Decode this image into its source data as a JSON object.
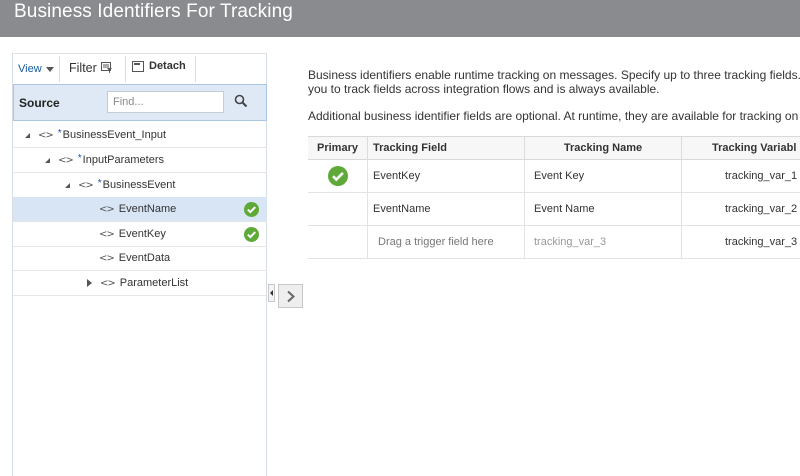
{
  "header": {
    "title": "Business Identifiers For Tracking"
  },
  "toolbar": {
    "view_label": "View",
    "filter_label": "Filter",
    "detach_label": "Detach"
  },
  "source": {
    "label": "Source",
    "find_placeholder": "Find..."
  },
  "tree": [
    {
      "label": "BusinessEvent_Input",
      "required": "*",
      "expanded": true,
      "tracked": false
    },
    {
      "label": "InputParameters",
      "required": "*",
      "expanded": true,
      "tracked": false
    },
    {
      "label": "BusinessEvent",
      "required": "*",
      "expanded": true,
      "tracked": false
    },
    {
      "label": "EventName",
      "required": "",
      "selected": true,
      "tracked": true
    },
    {
      "label": "EventKey",
      "required": "",
      "tracked": true
    },
    {
      "label": "EventData",
      "required": "",
      "tracked": false
    },
    {
      "label": "ParameterList",
      "required": "",
      "expanded": false,
      "tracked": false
    }
  ],
  "description": {
    "line1": "Business identifiers enable runtime tracking on messages. Specify up to three tracking fields.",
    "line2": "you to track fields across integration flows and is always available.",
    "line3": "Additional business identifier fields are optional. At runtime, they are available for tracking on"
  },
  "grid": {
    "headers": {
      "primary": "Primary",
      "tracking_field": "Tracking Field",
      "tracking_name": "Tracking Name",
      "tracking_variable": "Tracking Variabl"
    },
    "rows": [
      {
        "primary": true,
        "tracking_field": "EventKey",
        "tracking_name": "Event Key",
        "tracking_variable": "tracking_var_1"
      },
      {
        "primary": false,
        "tracking_field": "EventName",
        "tracking_name": "Event Name",
        "tracking_variable": "tracking_var_2"
      },
      {
        "primary": false,
        "tracking_field": "Drag a trigger field here",
        "tracking_name": "tracking_var_3",
        "tracking_variable": "tracking_var_3"
      }
    ]
  },
  "colors": {
    "title_bar": "#8a8b8f",
    "check": "#5ea937",
    "link": "#145c9e",
    "selection": "#d7e5f5"
  }
}
